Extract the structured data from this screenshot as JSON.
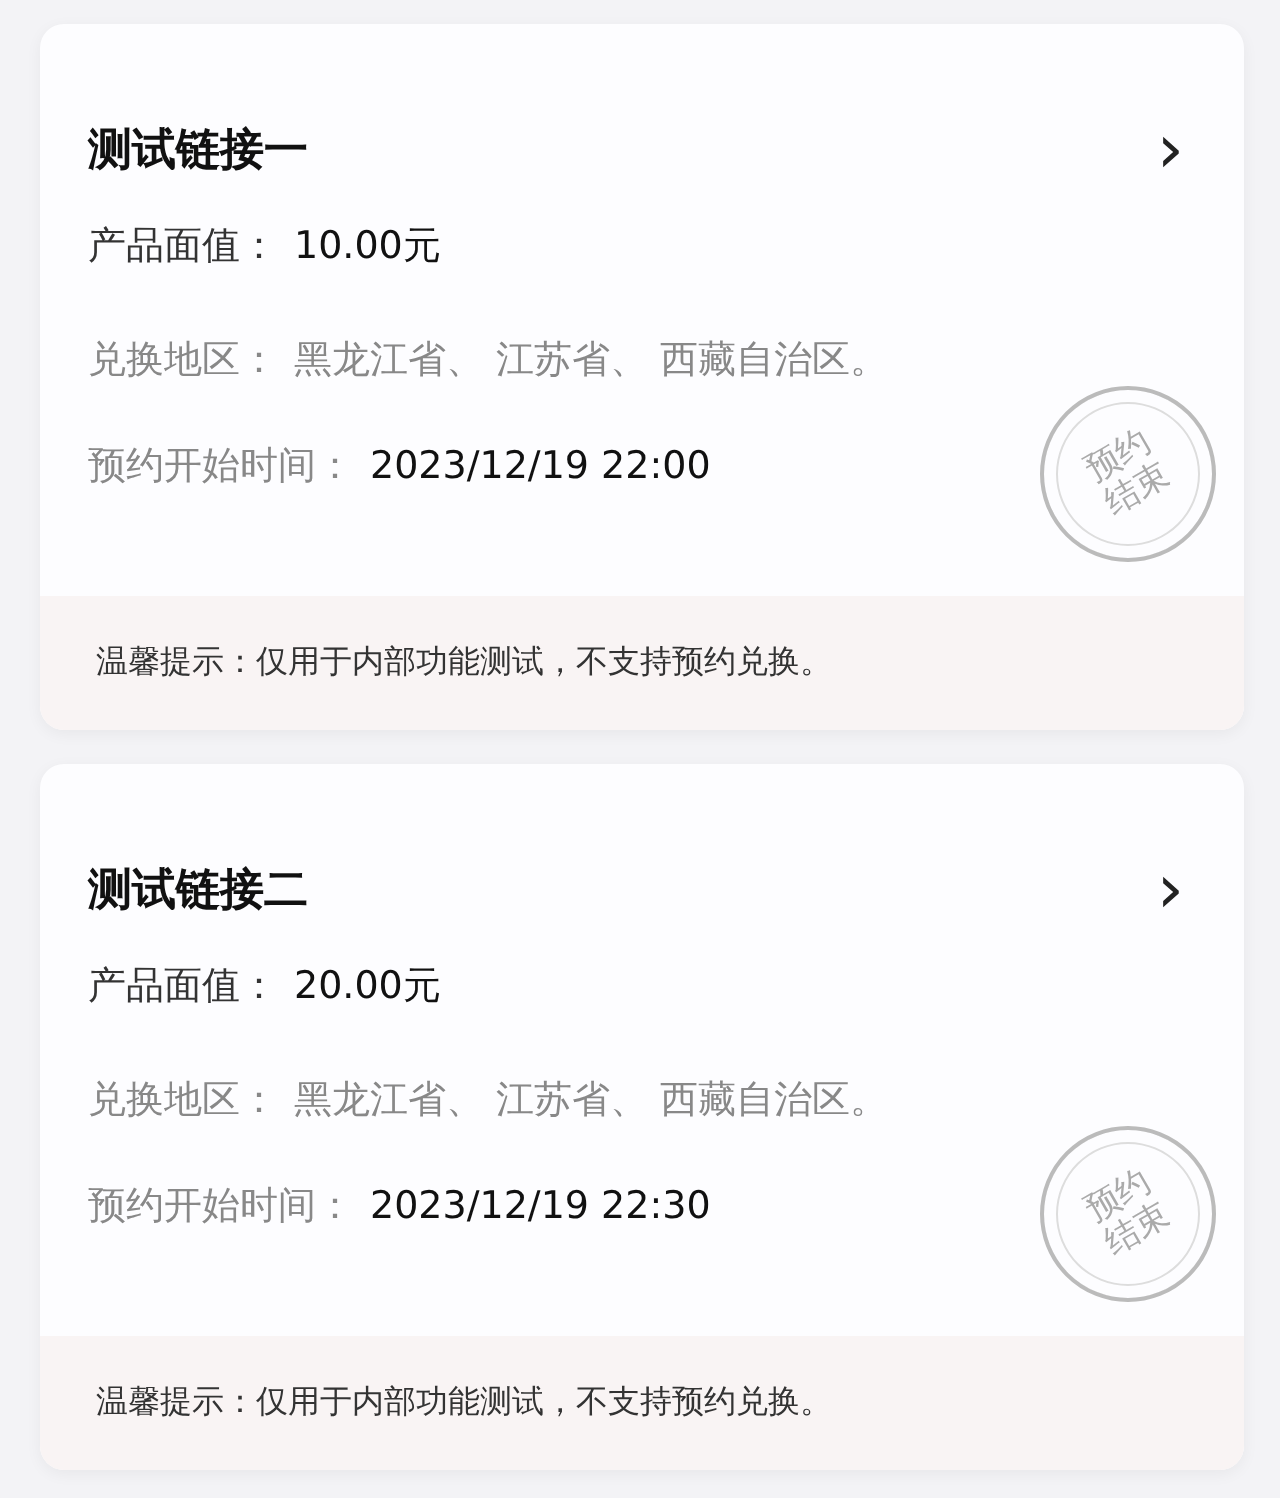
{
  "cards": [
    {
      "title": "测试链接一",
      "chevron": "›",
      "price_label": "产品面值：",
      "price": "10.00元",
      "region_label": "兑换地区：",
      "region": "黑龙江省、 江苏省、 西藏自治区。",
      "time_label": "预约开始时间：",
      "time": "2023/12/19 22:00",
      "stamp": "预约结束",
      "notice": "温馨提示：仅用于内部功能测试，不支持预约兑换。"
    },
    {
      "title": "测试链接二",
      "chevron": "›",
      "price_label": "产品面值：",
      "price": "20.00元",
      "region_label": "兑换地区：",
      "region": "黑龙江省、 江苏省、 西藏自治区。",
      "time_label": "预约开始时间：",
      "time": "2023/12/19 22:30",
      "stamp": "预约结束",
      "notice": "温馨提示：仅用于内部功能测试，不支持预约兑换。"
    }
  ]
}
